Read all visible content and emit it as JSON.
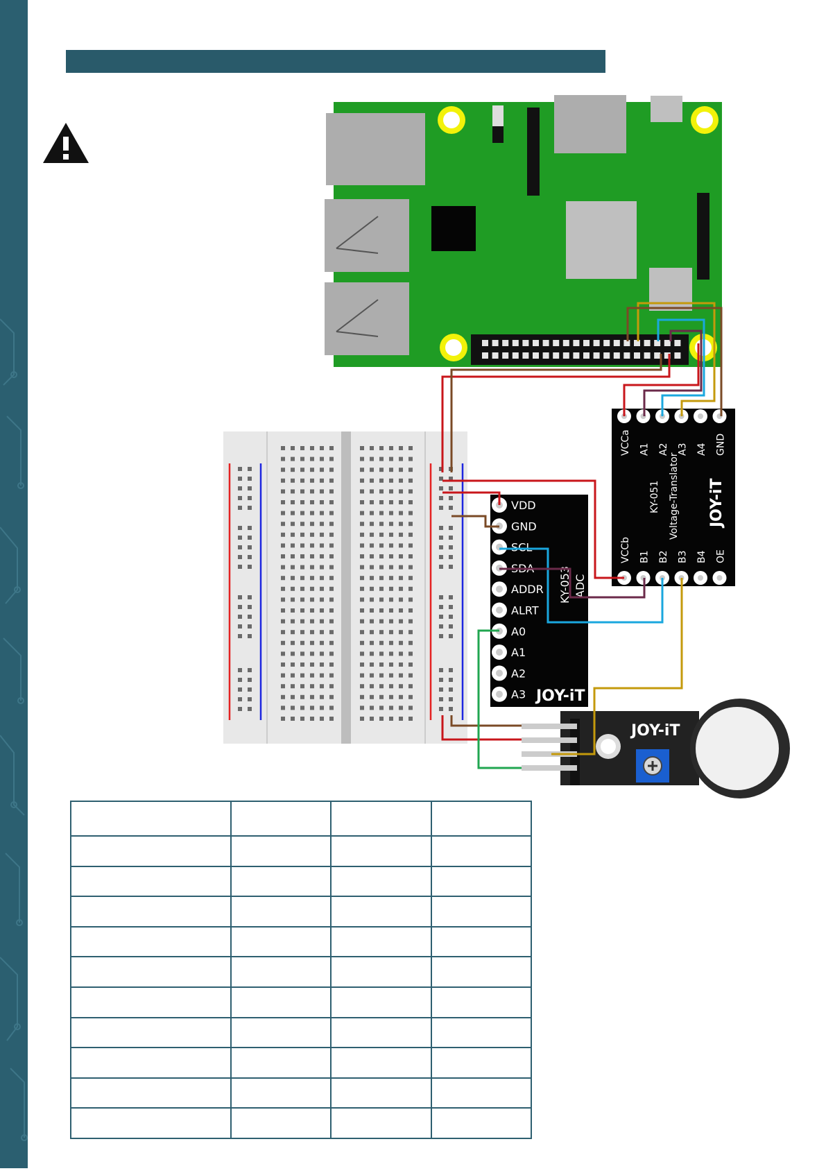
{
  "colors": {
    "sidebar": "#2b5f70",
    "title_bar": "#295a6a",
    "pcb_green": "#1f9c24",
    "wire_red": "#c8161b",
    "wire_brown": "#7a4a26",
    "wire_blue": "#1aa7de",
    "wire_purple": "#6b2a4a",
    "wire_gold": "#c49a0c",
    "wire_green": "#21a650"
  },
  "icons": {
    "warning": "warning-triangle-icon",
    "potentiometer": "plus-circle-icon"
  },
  "adc": {
    "pins": [
      "VDD",
      "GND",
      "SCL",
      "SDA",
      "ADDR",
      "ALRT",
      "A0",
      "A1",
      "A2",
      "A3"
    ],
    "model": "KY-053",
    "type": "ADC",
    "logo": "JOY-iT"
  },
  "translator": {
    "top_pins": [
      "VCCa",
      "A1",
      "A2",
      "A3",
      "A4",
      "GND"
    ],
    "bottom_pins": [
      "VCCb",
      "B1",
      "B2",
      "B3",
      "B4",
      "OE"
    ],
    "model": "KY-051",
    "type": "Voltage-Translator",
    "logo": "JOY-iT"
  },
  "sensor": {
    "logo": "JOY-iT"
  },
  "table": {
    "rows": [
      [
        "",
        "",
        "",
        ""
      ],
      [
        "",
        "",
        "",
        ""
      ],
      [
        "",
        "",
        "",
        ""
      ],
      [
        "",
        "",
        "",
        ""
      ],
      [
        "",
        "",
        "",
        ""
      ],
      [
        "",
        "",
        "",
        ""
      ],
      [
        "",
        "",
        "",
        ""
      ],
      [
        "",
        "",
        "",
        ""
      ],
      [
        "",
        "",
        "",
        ""
      ],
      [
        "",
        "",
        "",
        ""
      ],
      [
        "",
        "",
        "",
        ""
      ]
    ]
  }
}
